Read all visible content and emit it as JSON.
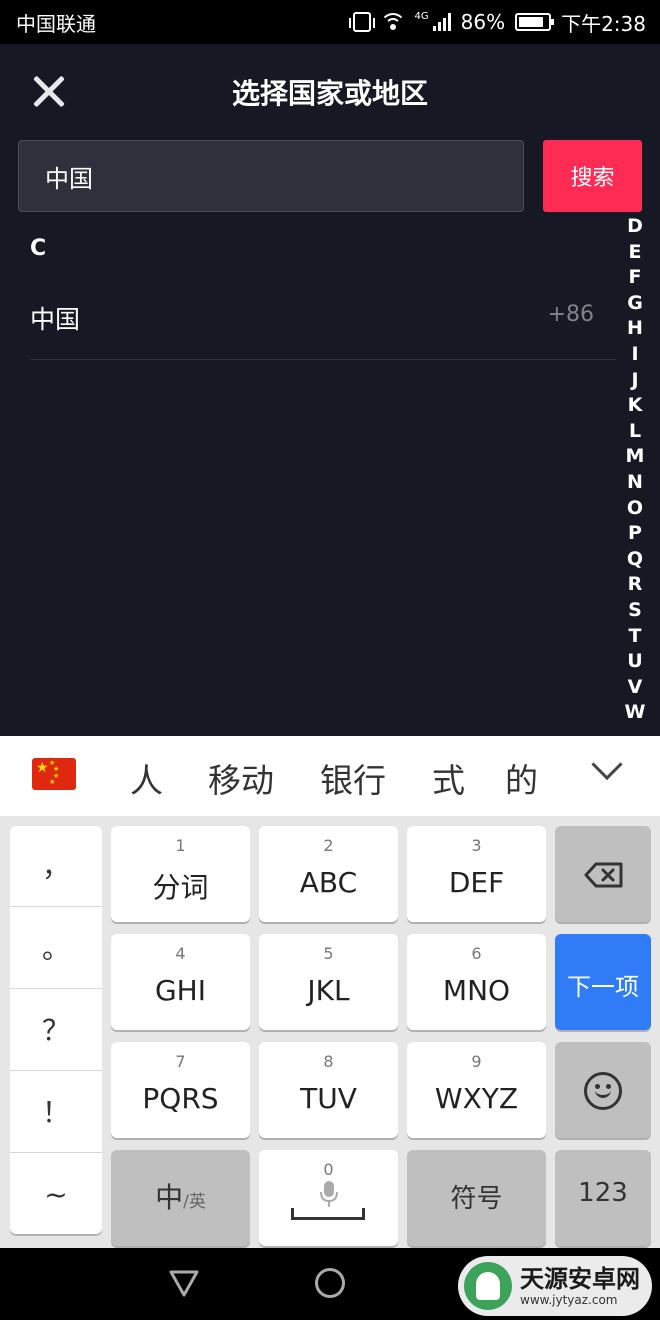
{
  "status_bar": {
    "carrier": "中国联通",
    "network": "4G",
    "battery": "86%",
    "battery_level": 0.86,
    "time": "下午2:38"
  },
  "header": {
    "title": "选择国家或地区",
    "close_icon": "close-icon"
  },
  "search": {
    "value": "中国",
    "button_label": "搜索"
  },
  "colors": {
    "accent": "#fe2c55",
    "background": "#161824",
    "keyboard_action": "#2f7cf6"
  },
  "list": {
    "sections": [
      {
        "letter": "C",
        "items": [
          {
            "name": "中国",
            "code": "+86"
          }
        ]
      }
    ]
  },
  "index_letters": [
    "D",
    "E",
    "F",
    "G",
    "H",
    "I",
    "J",
    "K",
    "L",
    "M",
    "N",
    "O",
    "P",
    "Q",
    "R",
    "S",
    "T",
    "U",
    "V",
    "W"
  ],
  "keyboard": {
    "candidates": [
      "人",
      "移动",
      "银行",
      "式",
      "的"
    ],
    "punctuation": [
      "，",
      "。",
      "？",
      "！",
      "~"
    ],
    "rows": [
      [
        {
          "num": "1",
          "label": "分词"
        },
        {
          "num": "2",
          "label": "ABC"
        },
        {
          "num": "3",
          "label": "DEF"
        }
      ],
      [
        {
          "num": "4",
          "label": "GHI"
        },
        {
          "num": "5",
          "label": "JKL"
        },
        {
          "num": "6",
          "label": "MNO"
        }
      ],
      [
        {
          "num": "7",
          "label": "PQRS"
        },
        {
          "num": "8",
          "label": "TUV"
        },
        {
          "num": "9",
          "label": "WXYZ"
        }
      ]
    ],
    "next_label": "下一项",
    "lang_main": "中",
    "lang_sub": "/英",
    "space_num": "0",
    "symbols_label": "符号",
    "numbers_label": "123"
  },
  "watermark": {
    "title": "天源安卓网",
    "url": "www.jytyaz.com"
  }
}
